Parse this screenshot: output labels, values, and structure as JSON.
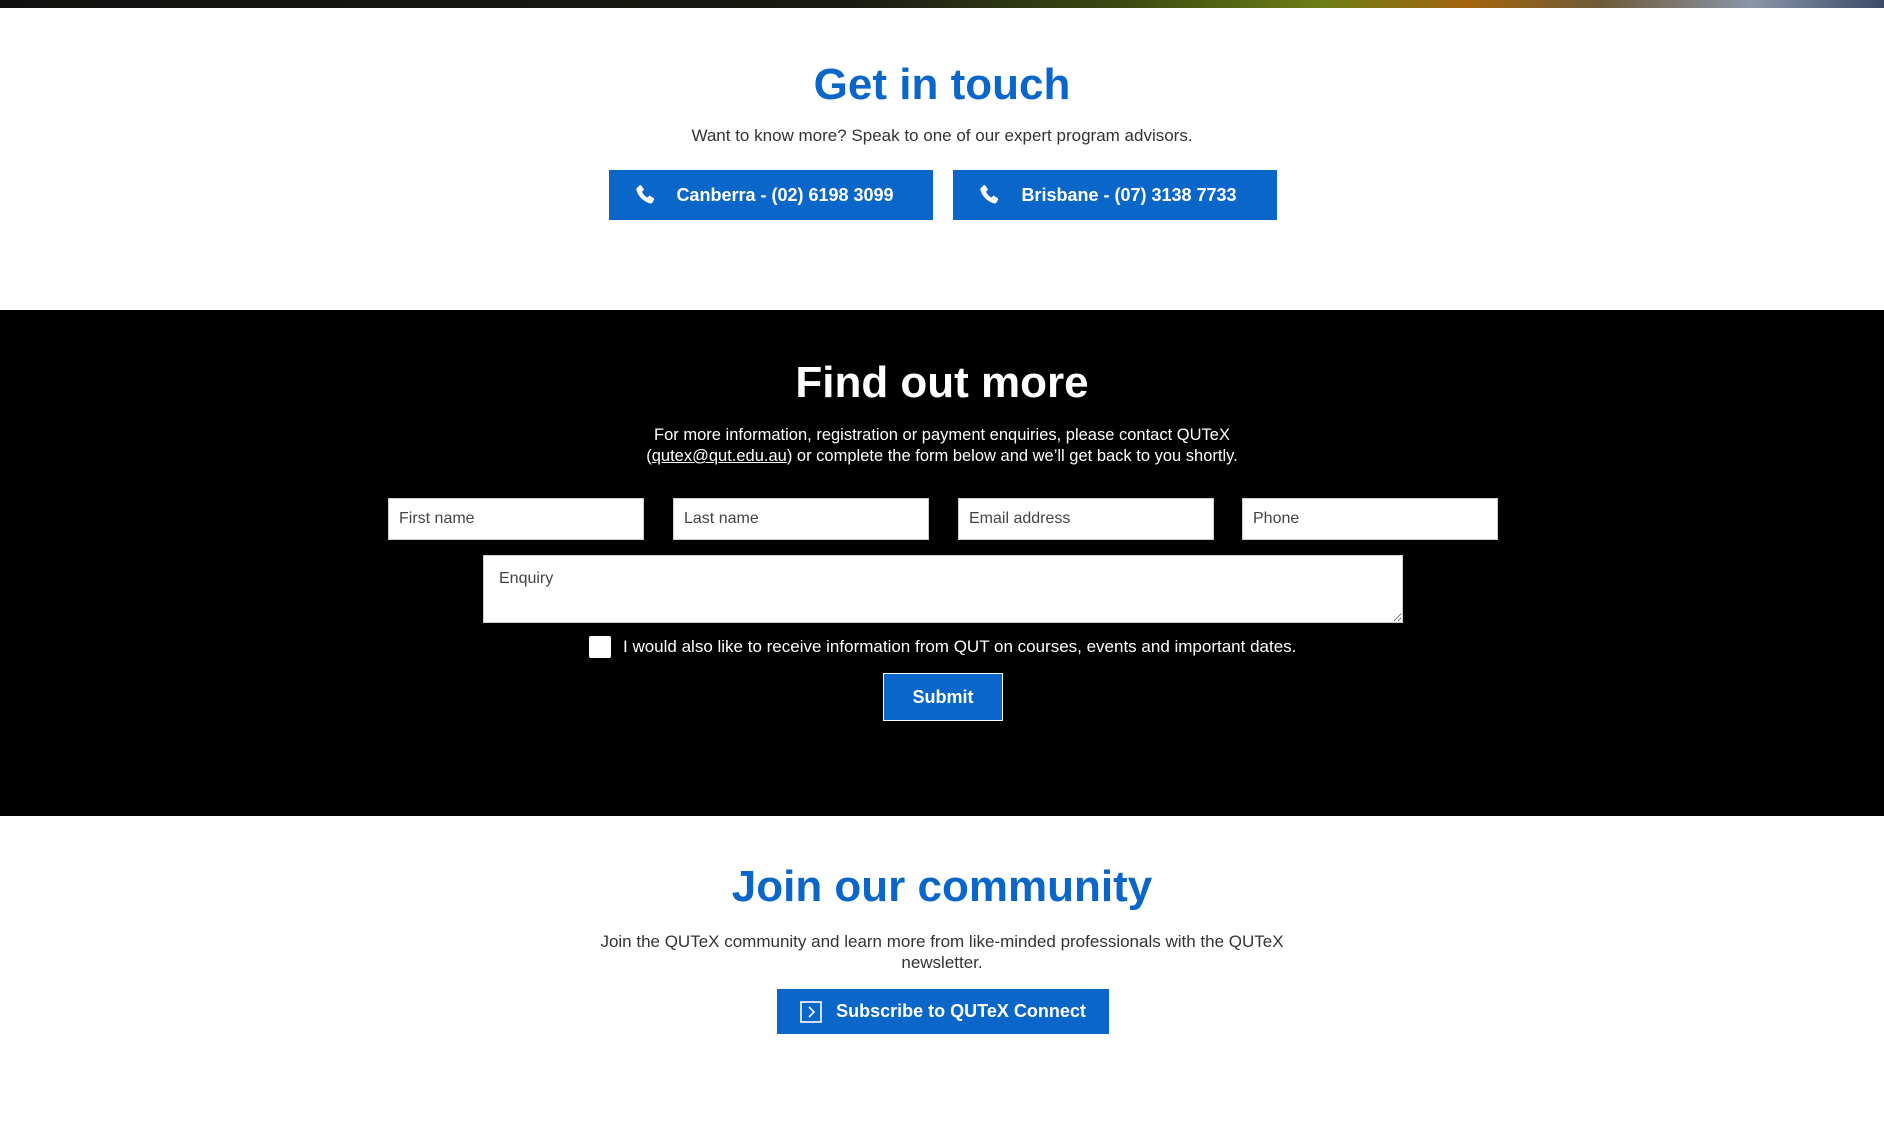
{
  "colors": {
    "brand_blue": "#0a66c8",
    "dark_section": "#000000"
  },
  "get_in_touch": {
    "title": "Get in touch",
    "subtitle": "Want to know more? Speak to one of our expert program advisors.",
    "buttons": [
      {
        "label": "Canberra - (02) 6198 3099",
        "icon": "phone-icon"
      },
      {
        "label": "Brisbane - (07) 3138 7733",
        "icon": "phone-icon"
      }
    ]
  },
  "find_out_more": {
    "title": "Find out more",
    "intro_before": "For more information, registration or payment enquiries, please contact QUTeX (",
    "email_link": "qutex@qut.edu.au",
    "intro_after": ") or complete the form below and we’ll get back to you shortly.",
    "fields": {
      "first_name": {
        "placeholder": "First name",
        "value": ""
      },
      "last_name": {
        "placeholder": "Last name",
        "value": ""
      },
      "email": {
        "placeholder": "Email address",
        "value": ""
      },
      "phone": {
        "placeholder": "Phone",
        "value": ""
      },
      "enquiry": {
        "placeholder": "Enquiry",
        "value": ""
      }
    },
    "optin_label": "I would also like to receive information from QUT on courses, events and important dates.",
    "optin_checked": false,
    "submit_label": "Submit"
  },
  "join_community": {
    "title": "Join our community",
    "description": "Join the QUTeX community and learn more from like-minded professionals with the QUTeX newsletter.",
    "subscribe_label": "Subscribe to QUTeX Connect",
    "subscribe_icon": "chevron-right-box-icon"
  }
}
